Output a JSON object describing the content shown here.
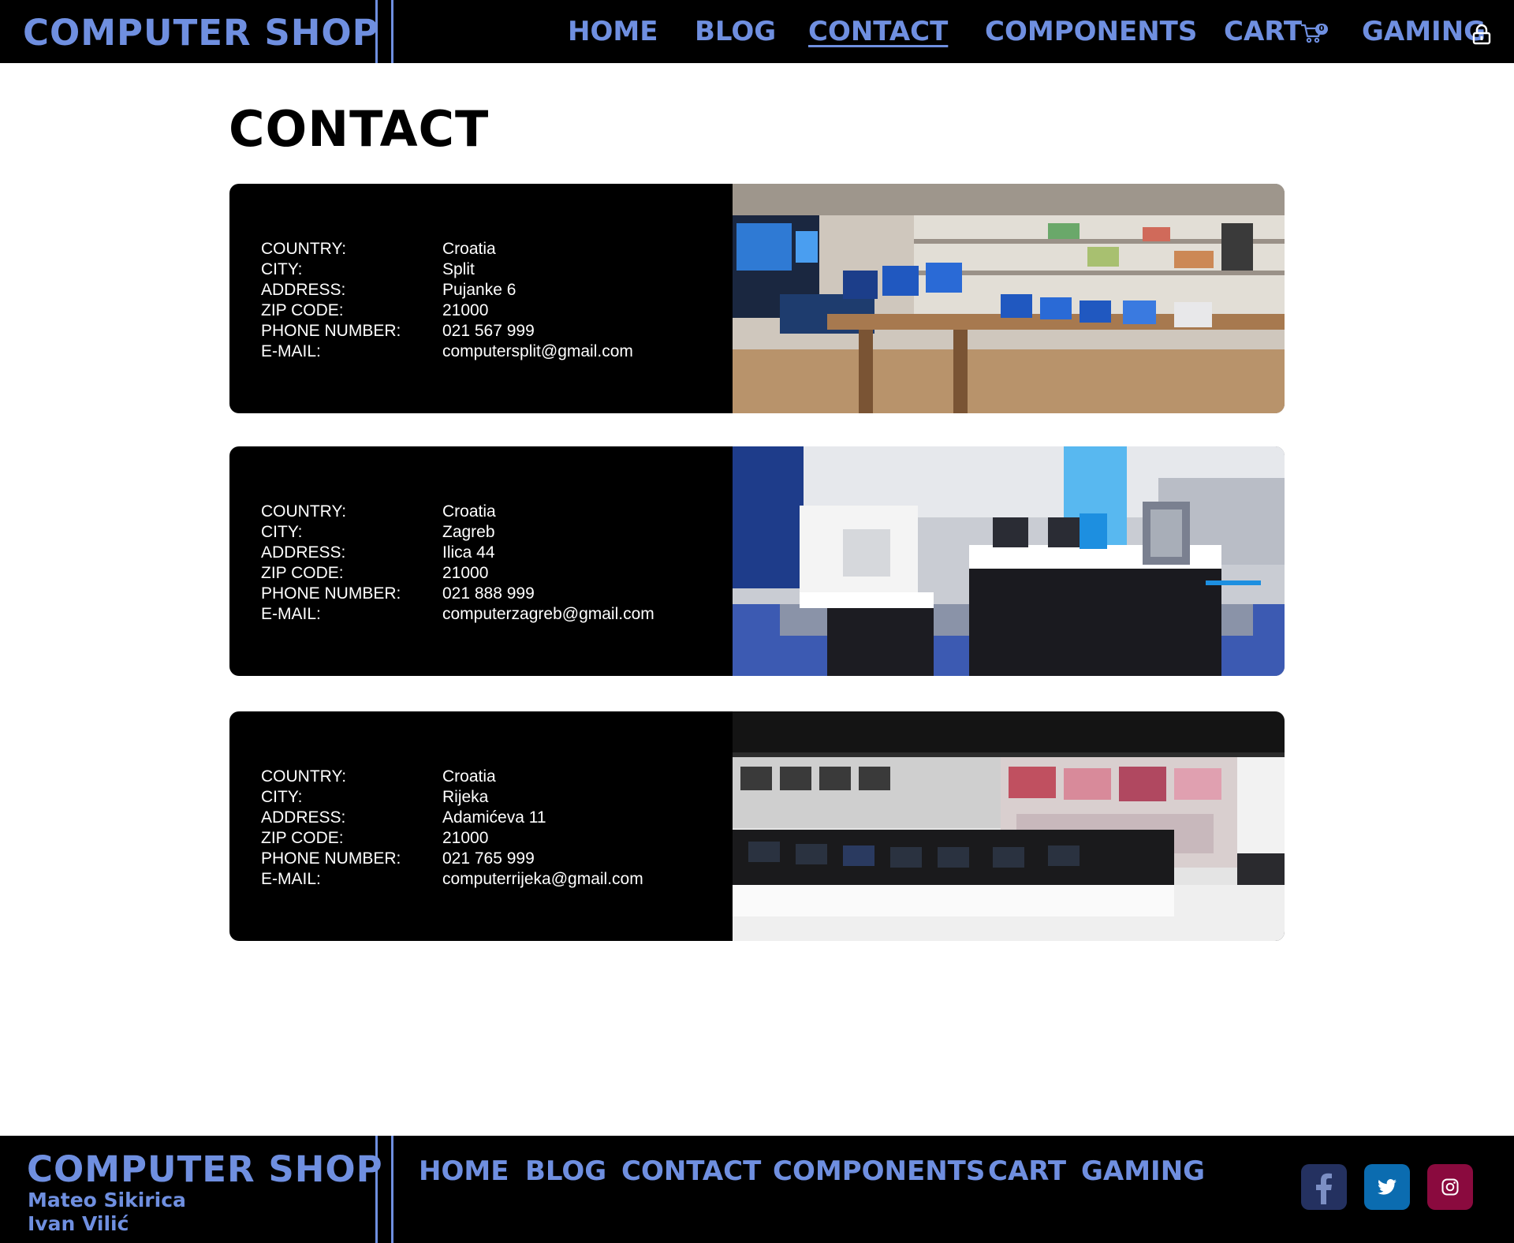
{
  "header": {
    "logo": "COMPUTER SHOP",
    "nav": {
      "home": "HOME",
      "blog": "BLOG",
      "contact": "CONTACT",
      "components": "COMPONENTS",
      "cart": "CART",
      "gaming": "GAMING"
    },
    "cart_count": "0",
    "active_nav": "contact"
  },
  "main": {
    "title": "CONTACT",
    "labels": {
      "country": "COUNTRY:",
      "city": "CITY:",
      "address": "ADDRESS:",
      "zip": "ZIP CODE:",
      "phone": "PHONE NUMBER:",
      "email": "E-MAIL:"
    },
    "stores": [
      {
        "country": "Croatia",
        "city": "Split",
        "address": "Pujanke 6",
        "zip": "21000",
        "phone": "021 567 999",
        "email": "computersplit@gmail.com"
      },
      {
        "country": "Croatia",
        "city": "Zagreb",
        "address": "Ilica 44",
        "zip": "21000",
        "phone": "021 888 999",
        "email": "computerzagreb@gmail.com"
      },
      {
        "country": "Croatia",
        "city": "Rijeka",
        "address": "Adamićeva 11",
        "zip": "21000",
        "phone": "021 765 999",
        "email": "computerrijeka@gmail.com"
      }
    ]
  },
  "footer": {
    "logo": "COMPUTER SHOP",
    "authors": [
      "Mateo Sikirica",
      "Ivan Vilić"
    ],
    "links": {
      "home": "HOME",
      "blog": "BLOG",
      "contact": "CONTACT",
      "components": "COMPONENTS",
      "cart": "CART",
      "gaming": "GAMING"
    },
    "social": [
      "facebook-icon",
      "twitter-icon",
      "instagram-icon"
    ]
  },
  "colors": {
    "accent": "#6f8fe0",
    "bar": "#000000",
    "card": "#000000",
    "facebook": "#243160",
    "twitter": "#0b6cb0",
    "instagram": "#8a0a3e"
  }
}
